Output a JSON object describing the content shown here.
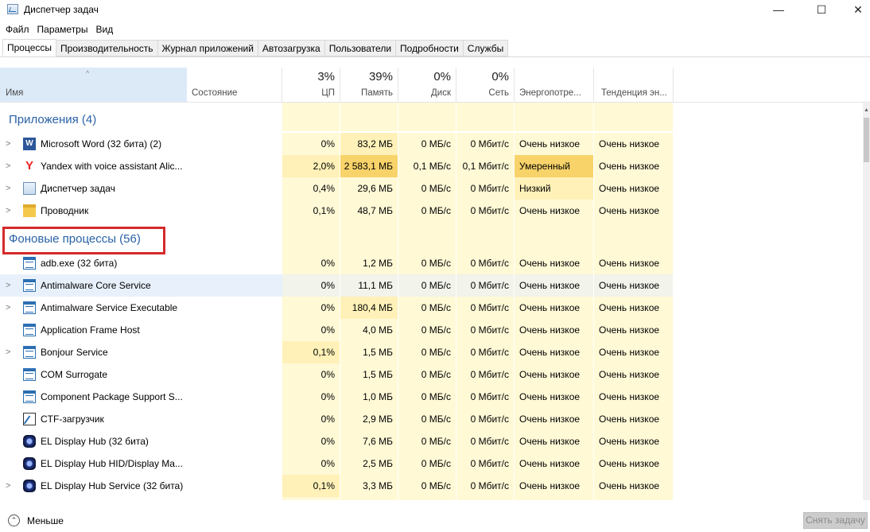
{
  "window": {
    "title": "Диспетчер задач",
    "minimize": "—",
    "maximize": "☐",
    "close": "✕"
  },
  "menu": [
    "Файл",
    "Параметры",
    "Вид"
  ],
  "tabs": [
    "Процессы",
    "Производительность",
    "Журнал приложений",
    "Автозагрузка",
    "Пользователи",
    "Подробности",
    "Службы"
  ],
  "columns": {
    "name": "Имя",
    "status": "Состояние",
    "cpu_pct": "3%",
    "cpu": "ЦП",
    "mem_pct": "39%",
    "mem": "Память",
    "disk_pct": "0%",
    "disk": "Диск",
    "net_pct": "0%",
    "net": "Сеть",
    "power": "Энергопотре...",
    "power_trend": "Тенденция эн..."
  },
  "groups": {
    "apps": "Приложения (4)",
    "background": "Фоновые процессы (56)"
  },
  "apps": [
    {
      "name": "Microsoft Word (32 бита) (2)",
      "icon": "word-icon",
      "cpu": "0%",
      "mem": "83,2 МБ",
      "disk": "0 МБ/с",
      "net": "0 Мбит/с",
      "power": "Очень низкое",
      "trend": "Очень низкое"
    },
    {
      "name": "Yandex with voice assistant Alic...",
      "icon": "yandex-icon",
      "cpu": "2,0%",
      "mem": "2 583,1 МБ",
      "disk": "0,1 МБ/с",
      "net": "0,1 Мбит/с",
      "power": "Умеренный",
      "trend": "Очень низкое"
    },
    {
      "name": "Диспетчер задач",
      "icon": "task-manager-icon",
      "cpu": "0,4%",
      "mem": "29,6 МБ",
      "disk": "0 МБ/с",
      "net": "0 Мбит/с",
      "power": "Низкий",
      "trend": "Очень низкое"
    },
    {
      "name": "Проводник",
      "icon": "folder-icon",
      "cpu": "0,1%",
      "mem": "48,7 МБ",
      "disk": "0 МБ/с",
      "net": "0 Мбит/с",
      "power": "Очень низкое",
      "trend": "Очень низкое"
    }
  ],
  "background": [
    {
      "name": "adb.exe (32 бита)",
      "icon": "window-icon",
      "cpu": "0%",
      "mem": "1,2 МБ",
      "disk": "0 МБ/с",
      "net": "0 Мбит/с",
      "power": "Очень низкое",
      "trend": "Очень низкое"
    },
    {
      "name": "Antimalware Core Service",
      "icon": "window-icon",
      "cpu": "0%",
      "mem": "11,1 МБ",
      "disk": "0 МБ/с",
      "net": "0 Мбит/с",
      "power": "Очень низкое",
      "trend": "Очень низкое"
    },
    {
      "name": "Antimalware Service Executable",
      "icon": "window-icon",
      "cpu": "0%",
      "mem": "180,4 МБ",
      "disk": "0 МБ/с",
      "net": "0 Мбит/с",
      "power": "Очень низкое",
      "trend": "Очень низкое"
    },
    {
      "name": "Application Frame Host",
      "icon": "window-icon",
      "cpu": "0%",
      "mem": "4,0 МБ",
      "disk": "0 МБ/с",
      "net": "0 Мбит/с",
      "power": "Очень низкое",
      "trend": "Очень низкое"
    },
    {
      "name": "Bonjour Service",
      "icon": "window-icon",
      "cpu": "0,1%",
      "mem": "1,5 МБ",
      "disk": "0 МБ/с",
      "net": "0 Мбит/с",
      "power": "Очень низкое",
      "trend": "Очень низкое"
    },
    {
      "name": "COM Surrogate",
      "icon": "window-icon",
      "cpu": "0%",
      "mem": "1,5 МБ",
      "disk": "0 МБ/с",
      "net": "0 Мбит/с",
      "power": "Очень низкое",
      "trend": "Очень низкое"
    },
    {
      "name": "Component Package Support S...",
      "icon": "window-icon",
      "cpu": "0%",
      "mem": "1,0 МБ",
      "disk": "0 МБ/с",
      "net": "0 Мбит/с",
      "power": "Очень низкое",
      "trend": "Очень низкое"
    },
    {
      "name": "CTF-загрузчик",
      "icon": "ctf-loader-icon",
      "cpu": "0%",
      "mem": "2,9 МБ",
      "disk": "0 МБ/с",
      "net": "0 Мбит/с",
      "power": "Очень низкое",
      "trend": "Очень низкое"
    },
    {
      "name": "EL Display Hub (32 бита)",
      "icon": "el-display-icon",
      "cpu": "0%",
      "mem": "7,6 МБ",
      "disk": "0 МБ/с",
      "net": "0 Мбит/с",
      "power": "Очень низкое",
      "trend": "Очень низкое"
    },
    {
      "name": "EL Display Hub HID/Display Ma...",
      "icon": "el-display-icon",
      "cpu": "0%",
      "mem": "2,5 МБ",
      "disk": "0 МБ/с",
      "net": "0 Мбит/с",
      "power": "Очень низкое",
      "trend": "Очень низкое"
    },
    {
      "name": "EL Display Hub Service (32 бита)",
      "icon": "el-display-icon",
      "cpu": "0,1%",
      "mem": "3,3 МБ",
      "disk": "0 МБ/с",
      "net": "0 Мбит/с",
      "power": "Очень низкое",
      "trend": "Очень низкое"
    }
  ],
  "footer": {
    "fewer": "Меньше",
    "end_task": "Снять задачу"
  }
}
